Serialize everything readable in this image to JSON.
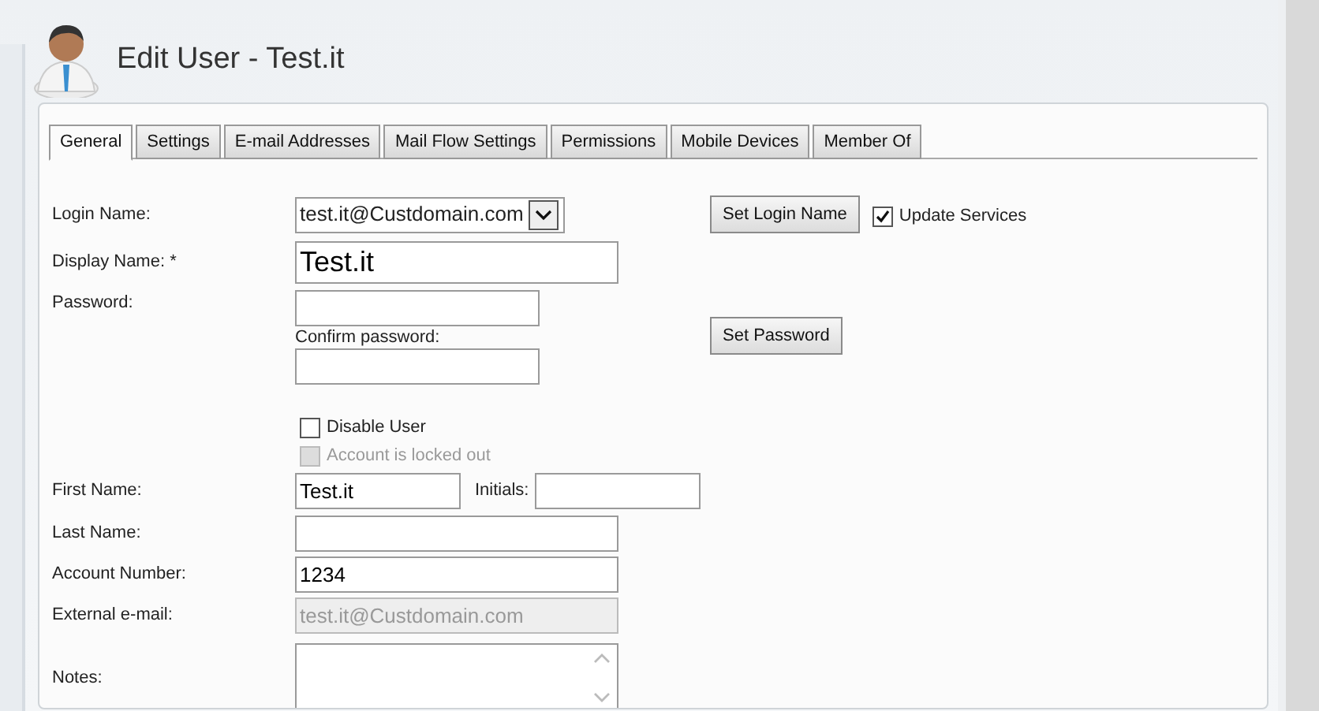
{
  "page": {
    "title": "Edit User - Test.it"
  },
  "tabs": [
    {
      "label": "General",
      "selected": true
    },
    {
      "label": "Settings",
      "selected": false
    },
    {
      "label": "E-mail Addresses",
      "selected": false
    },
    {
      "label": "Mail Flow Settings",
      "selected": false
    },
    {
      "label": "Permissions",
      "selected": false
    },
    {
      "label": "Mobile Devices",
      "selected": false
    },
    {
      "label": "Member Of",
      "selected": false
    }
  ],
  "login_name": {
    "label": "Login Name:",
    "value": "test.it@Custdomain.com",
    "button": "Set Login Name",
    "update_services": {
      "label": "Update Services",
      "checked": true
    }
  },
  "display_name": {
    "label": "Display Name: *",
    "value": "Test.it"
  },
  "password": {
    "label": "Password:",
    "confirm_label": "Confirm password:",
    "button": "Set Password"
  },
  "options": [
    {
      "label": "Disable User",
      "checked": false,
      "disabled": false
    },
    {
      "label": "Account is locked out",
      "checked": false,
      "disabled": true
    }
  ],
  "first_name": {
    "label": "First Name:",
    "value": "Test.it",
    "initials_label": "Initials:"
  },
  "last_name": {
    "label": "Last Name:"
  },
  "account_number": {
    "label": "Account Number:",
    "value": "1234"
  },
  "external_email": {
    "label": "External e-mail:",
    "value": "test.it@Custdomain.com",
    "disabled": true
  },
  "notes": {
    "label": "Notes:"
  }
}
